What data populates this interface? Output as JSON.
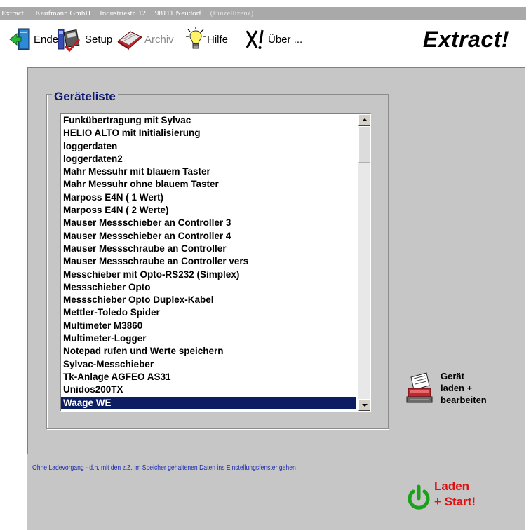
{
  "titlebar": {
    "app": "Extract!",
    "company": "Kaufmann GmbH",
    "street": "Industriestr. 12",
    "city": "98111 Neudorf",
    "license": "(Einzellizenz)"
  },
  "toolbar": {
    "exit_label": "Ende",
    "setup_label": "Setup",
    "archive_label": "Archiv",
    "help_label": "Hilfe",
    "about_label": "Über ...",
    "logo": "Extract!"
  },
  "device_list": {
    "title": "Geräteliste",
    "items": [
      "Funkübertragung mit Sylvac",
      "HELIO ALTO  mit Initialisierung",
      "loggerdaten",
      "loggerdaten2",
      "Mahr Messuhr mit blauem Taster",
      "Mahr Messuhr ohne blauem Taster",
      "Marposs E4N ( 1 Wert)",
      "Marposs E4N ( 2 Werte)",
      "Mauser Messschieber an Controller 3",
      "Mauser Messschieber an Controller 4",
      "Mauser Messschraube an Controller",
      "Mauser Messschraube an Controller vers",
      "Messchieber mit Opto-RS232 (Simplex)",
      "Messschieber Opto",
      "Messschieber Opto Duplex-Kabel",
      "Mettler-Toledo Spider",
      "Multimeter M3860",
      "Multimeter-Logger",
      "Notepad rufen und Werte speichern",
      "Sylvac-Messchieber",
      "Tk-Anlage AGFEO AS31",
      "Unidos200TX",
      "Waage WE"
    ],
    "selected": "Waage WE"
  },
  "load_edit_button": {
    "label": "Gerät\nladen +\nbearbeiten"
  },
  "status": {
    "text": "Ohne Ladevorgang - d.h. mit den z.Z. im Speicher gehaltenen Daten ins Einstellungsfenster gehen"
  },
  "start_button": {
    "label": "Laden\n+ Start!"
  },
  "colors": {
    "selection": "#0c1d63",
    "group_title": "#0c1770",
    "status_text": "#1a2bb0",
    "start_text": "#e01010",
    "power_icon": "#1aa01a"
  }
}
